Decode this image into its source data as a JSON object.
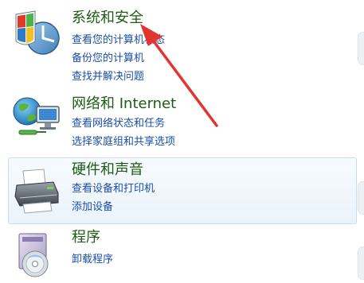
{
  "categories": [
    {
      "title": "系统和安全",
      "icon": "security-shield-icon",
      "links": [
        "查看您的计算机状态",
        "备份您的计算机",
        "查找并解决问题"
      ]
    },
    {
      "title": "网络和 Internet",
      "icon": "network-globe-icon",
      "links": [
        "查看网络状态和任务",
        "选择家庭组和共享选项"
      ]
    },
    {
      "title": "硬件和声音",
      "icon": "printer-icon",
      "links": [
        "查看设备和打印机",
        "添加设备"
      ]
    },
    {
      "title": "程序",
      "icon": "programs-disc-icon",
      "links": [
        "卸载程序"
      ]
    }
  ],
  "colors": {
    "title_green": "#1e5b12",
    "link_blue": "#1a4ea8",
    "hover_border": "#c7dcef",
    "annotation_arrow": "#e3342f"
  }
}
